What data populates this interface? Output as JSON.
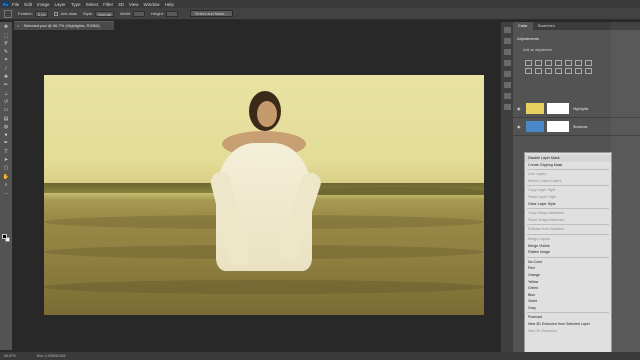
{
  "menubar": {
    "logo": "Ps",
    "items": [
      "File",
      "Edit",
      "Image",
      "Layer",
      "Type",
      "Select",
      "Filter",
      "3D",
      "View",
      "Window",
      "Help"
    ]
  },
  "options": {
    "feather_label": "Feather:",
    "feather_value": "0 px",
    "antialias_label": "Anti-alias",
    "style_label": "Style:",
    "style_value": "Normal",
    "width_label": "Width:",
    "height_label": "Height:",
    "select_mask_label": "Select and Mask..."
  },
  "document": {
    "tab_title": "Selected.psd @ 66.7% (Highlights, RGB/8)",
    "close_glyph": "×"
  },
  "status": {
    "zoom": "66.67%",
    "doc_size": "Doc: 2.92M/5.01M"
  },
  "panels": {
    "tabs": [
      "Color",
      "Swatches"
    ],
    "adjustments_tab": "Adjustments",
    "adjustments_hint": "Add an adjustment",
    "layers": [
      {
        "name": "Highlights",
        "thumb_color": "#e8d060"
      },
      {
        "name": "Shadows",
        "thumb_color": "#4a88c8"
      }
    ]
  },
  "context_menu": {
    "items": [
      {
        "label": "Disable Layer Mask",
        "state": "hl"
      },
      {
        "label": "Create Clipping Mask",
        "state": "normal"
      },
      {
        "sep": true
      },
      {
        "label": "Link Layers",
        "state": "dis"
      },
      {
        "label": "Select Linked Layers",
        "state": "dis"
      },
      {
        "sep": true
      },
      {
        "label": "Copy Layer Style",
        "state": "dis"
      },
      {
        "label": "Paste Layer Style",
        "state": "dis"
      },
      {
        "label": "Clear Layer Style",
        "state": "normal"
      },
      {
        "sep": true
      },
      {
        "label": "Copy Shape Attributes",
        "state": "dis"
      },
      {
        "label": "Paste Shape Attributes",
        "state": "dis"
      },
      {
        "sep": true
      },
      {
        "label": "Release from Isolation",
        "state": "dis"
      },
      {
        "sep": true
      },
      {
        "label": "Merge Layers",
        "state": "dis"
      },
      {
        "label": "Merge Visible",
        "state": "normal"
      },
      {
        "label": "Flatten Image",
        "state": "normal"
      },
      {
        "sep": true
      },
      {
        "label": "No Color",
        "state": "normal"
      },
      {
        "label": "Red",
        "state": "normal"
      },
      {
        "label": "Orange",
        "state": "normal"
      },
      {
        "label": "Yellow",
        "state": "normal"
      },
      {
        "label": "Green",
        "state": "normal"
      },
      {
        "label": "Blue",
        "state": "normal"
      },
      {
        "label": "Violet",
        "state": "normal"
      },
      {
        "label": "Gray",
        "state": "normal"
      },
      {
        "sep": true
      },
      {
        "label": "Postcard",
        "state": "normal"
      },
      {
        "label": "New 3D Extrusion from Selected Layer",
        "state": "normal"
      },
      {
        "label": "New 3D Extrusion",
        "state": "dis"
      }
    ]
  }
}
